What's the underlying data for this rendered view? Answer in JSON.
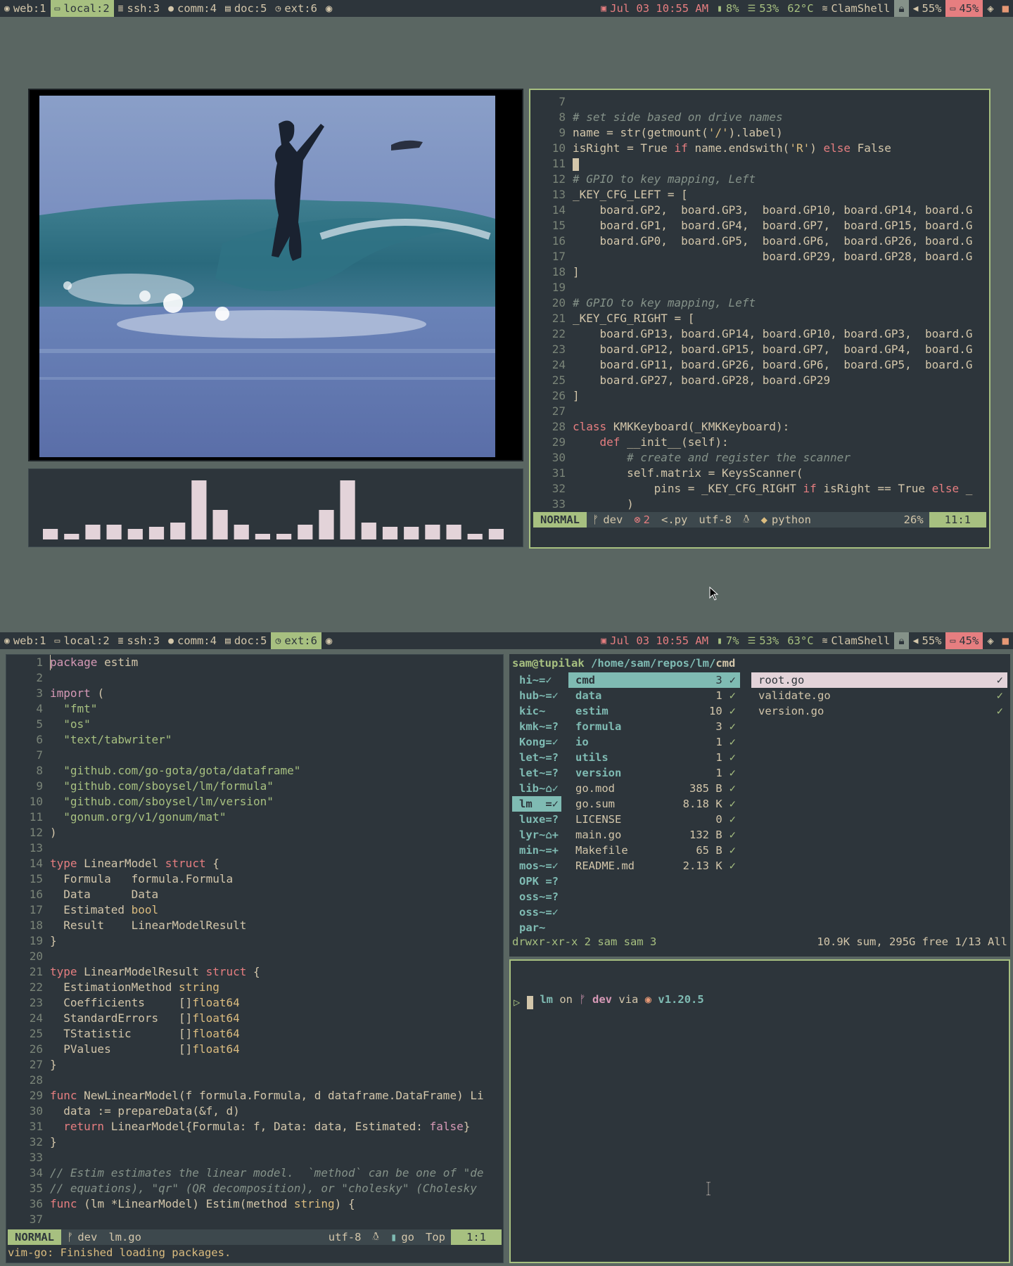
{
  "top_bar": {
    "workspaces": [
      {
        "icon": "chrome-icon",
        "label": "web:1",
        "active": false
      },
      {
        "icon": "monitor-icon",
        "label": "local:2",
        "active": true
      },
      {
        "icon": "server-icon",
        "label": "ssh:3",
        "active": false
      },
      {
        "icon": "chat-icon",
        "label": "comm:4",
        "active": false
      },
      {
        "icon": "document-icon",
        "label": "doc:5",
        "active": false
      },
      {
        "icon": "refresh-icon",
        "label": "ext:6",
        "active": false
      }
    ],
    "eye_icon": "eye-icon",
    "date": "Jul 03 10:55 AM",
    "memory": "8%",
    "cpu": "53%",
    "temp": "62°C",
    "wifi": "ClamShell",
    "volume": "55%",
    "battery": "45%"
  },
  "bottom_bar": {
    "workspaces": [
      {
        "label": "web:1",
        "active": false
      },
      {
        "label": "local:2",
        "active": false
      },
      {
        "label": "ssh:3",
        "active": false
      },
      {
        "label": "comm:4",
        "active": false
      },
      {
        "label": "doc:5",
        "active": false
      },
      {
        "label": "ext:6",
        "active": true
      }
    ],
    "date": "Jul 03 10:55 AM",
    "memory": "7%",
    "cpu": "53%",
    "temp": "63°C",
    "wifi": "ClamShell",
    "volume": "55%",
    "battery": "45%"
  },
  "visualizer": {
    "levels": [
      0.18,
      0.1,
      0.25,
      0.25,
      0.18,
      0.22,
      0.28,
      1.0,
      0.5,
      0.25,
      0.1,
      0.1,
      0.25,
      0.5,
      1.0,
      0.28,
      0.22,
      0.22,
      0.25,
      0.25,
      0.1,
      0.18
    ]
  },
  "python_editor": {
    "lines": [
      {
        "n": "7",
        "t": ""
      },
      {
        "n": "8",
        "t": "# set side based on drive names",
        "c": "cm"
      },
      {
        "n": "9",
        "t": "name = str(getmount('/').label)"
      },
      {
        "n": "10",
        "t": "isRight = True if name.endswith('R') else False"
      },
      {
        "n": "11",
        "t": ""
      },
      {
        "n": "12",
        "t": "# GPIO to key mapping, Left",
        "c": "cm"
      },
      {
        "n": "13",
        "t": "_KEY_CFG_LEFT = ["
      },
      {
        "n": "14",
        "t": "    board.GP2,  board.GP3,  board.GP10, board.GP14, board.G"
      },
      {
        "n": "15",
        "t": "    board.GP1,  board.GP4,  board.GP7,  board.GP15, board.G"
      },
      {
        "n": "16",
        "t": "    board.GP0,  board.GP5,  board.GP6,  board.GP26, board.G"
      },
      {
        "n": "17",
        "t": "                            board.GP29, board.GP28, board.G"
      },
      {
        "n": "18",
        "t": "]"
      },
      {
        "n": "19",
        "t": ""
      },
      {
        "n": "20",
        "t": "# GPIO to key mapping, Left",
        "c": "cm"
      },
      {
        "n": "21",
        "t": "_KEY_CFG_RIGHT = ["
      },
      {
        "n": "22",
        "t": "    board.GP13, board.GP14, board.GP10, board.GP3,  board.G"
      },
      {
        "n": "23",
        "t": "    board.GP12, board.GP15, board.GP7,  board.GP4,  board.G"
      },
      {
        "n": "24",
        "t": "    board.GP11, board.GP26, board.GP6,  board.GP5,  board.G"
      },
      {
        "n": "25",
        "t": "    board.GP27, board.GP28, board.GP29"
      },
      {
        "n": "26",
        "t": "]"
      },
      {
        "n": "27",
        "t": ""
      },
      {
        "n": "28",
        "t": "class KMKKeyboard(_KMKKeyboard):"
      },
      {
        "n": "29",
        "t": "    def __init__(self):"
      },
      {
        "n": "30",
        "t": "        # create and register the scanner",
        "c": "cm"
      },
      {
        "n": "31",
        "t": "        self.matrix = KeysScanner("
      },
      {
        "n": "32",
        "t": "            pins = _KEY_CFG_RIGHT if isRight == True else _"
      },
      {
        "n": "33",
        "t": "        )"
      }
    ],
    "status": {
      "mode": "NORMAL",
      "branch": "dev",
      "errors": "2",
      "ext": "<.py",
      "enc": "utf-8",
      "lang": "python",
      "pct": "26%",
      "pos": "11:1"
    }
  },
  "go_editor": {
    "lines": [
      {
        "n": "1",
        "t": "package estim"
      },
      {
        "n": "2",
        "t": ""
      },
      {
        "n": "3",
        "t": "import ("
      },
      {
        "n": "4",
        "t": "  \"fmt\""
      },
      {
        "n": "5",
        "t": "  \"os\""
      },
      {
        "n": "6",
        "t": "  \"text/tabwriter\""
      },
      {
        "n": "7",
        "t": ""
      },
      {
        "n": "8",
        "t": "  \"github.com/go-gota/gota/dataframe\""
      },
      {
        "n": "9",
        "t": "  \"github.com/sboysel/lm/formula\""
      },
      {
        "n": "10",
        "t": "  \"github.com/sboysel/lm/version\""
      },
      {
        "n": "11",
        "t": "  \"gonum.org/v1/gonum/mat\""
      },
      {
        "n": "12",
        "t": ")"
      },
      {
        "n": "13",
        "t": ""
      },
      {
        "n": "14",
        "t": "type LinearModel struct {"
      },
      {
        "n": "15",
        "t": "  Formula   formula.Formula"
      },
      {
        "n": "16",
        "t": "  Data      Data"
      },
      {
        "n": "17",
        "t": "  Estimated bool"
      },
      {
        "n": "18",
        "t": "  Result    LinearModelResult"
      },
      {
        "n": "19",
        "t": "}"
      },
      {
        "n": "20",
        "t": ""
      },
      {
        "n": "21",
        "t": "type LinearModelResult struct {"
      },
      {
        "n": "22",
        "t": "  EstimationMethod string"
      },
      {
        "n": "23",
        "t": "  Coefficients     []float64"
      },
      {
        "n": "24",
        "t": "  StandardErrors   []float64"
      },
      {
        "n": "25",
        "t": "  TStatistic       []float64"
      },
      {
        "n": "26",
        "t": "  PValues          []float64"
      },
      {
        "n": "27",
        "t": "}"
      },
      {
        "n": "28",
        "t": ""
      },
      {
        "n": "29",
        "t": "func NewLinearModel(f formula.Formula, d dataframe.DataFrame) Li"
      },
      {
        "n": "30",
        "t": "  data := prepareData(&f, d)"
      },
      {
        "n": "31",
        "t": "  return LinearModel{Formula: f, Data: data, Estimated: false}"
      },
      {
        "n": "32",
        "t": "}"
      },
      {
        "n": "33",
        "t": ""
      },
      {
        "n": "34",
        "t": "// Estim estimates the linear model.  `method` can be one of \"de",
        "c": "cm"
      },
      {
        "n": "35",
        "t": "// equations), \"qr\" (QR decomposition), or \"cholesky\" (Cholesky",
        "c": "cm"
      },
      {
        "n": "36",
        "t": "func (lm *LinearModel) Estim(method string) {"
      },
      {
        "n": "37",
        "t": ""
      }
    ],
    "status": {
      "mode": "NORMAL",
      "branch": "dev",
      "file": "lm.go",
      "enc": "utf-8",
      "lang": "go",
      "pct": "Top",
      "pos": "1:1"
    },
    "message": "vim-go: Finished loading packages."
  },
  "file_manager": {
    "header_user": "sam@tupilak",
    "header_path": "/home/sam/repos/lm/",
    "header_dir": "cmd",
    "left": [
      "hi~=✓",
      "hub~=✓",
      "kic~",
      "kmk~=?",
      "Kong=✓",
      "let~=?",
      "let~=?",
      "lib~⌂✓",
      "lm  =✓",
      "luxe=?",
      "lyr~⌂+",
      "min~=+",
      "mos~=✓",
      "OPK =?",
      "oss~=?",
      "oss~=✓",
      "par~"
    ],
    "middle": [
      {
        "name": "cmd",
        "size": "3",
        "st": "✓",
        "dir": true
      },
      {
        "name": "data",
        "size": "1",
        "st": "✓",
        "dir": true
      },
      {
        "name": "estim",
        "size": "10",
        "st": "✓",
        "dir": true
      },
      {
        "name": "formula",
        "size": "3",
        "st": "✓",
        "dir": true
      },
      {
        "name": "io",
        "size": "1",
        "st": "✓",
        "dir": true
      },
      {
        "name": "utils",
        "size": "1",
        "st": "✓",
        "dir": true
      },
      {
        "name": "version",
        "size": "1",
        "st": "✓",
        "dir": true
      },
      {
        "name": "go.mod",
        "size": "385 B",
        "st": "✓",
        "dir": false
      },
      {
        "name": "go.sum",
        "size": "8.18 K",
        "st": "✓",
        "dir": false
      },
      {
        "name": "LICENSE",
        "size": "0",
        "st": "✓",
        "dir": false
      },
      {
        "name": "main.go",
        "size": "132 B",
        "st": "✓",
        "dir": false
      },
      {
        "name": "Makefile",
        "size": "65 B",
        "st": "✓",
        "dir": false
      },
      {
        "name": "README.md",
        "size": "2.13 K",
        "st": "✓",
        "dir": false
      }
    ],
    "right": [
      {
        "name": "root.go",
        "st": "✓"
      },
      {
        "name": "validate.go",
        "st": "✓"
      },
      {
        "name": "version.go",
        "st": "✓"
      }
    ],
    "footer_left": "drwxr-xr-x 2 sam sam 3",
    "footer_right": "10.9K sum, 295G free  1/13  All"
  },
  "terminal": {
    "dir": "lm",
    "on": "on",
    "branch": "dev",
    "via": "via",
    "version": "v1.20.5",
    "prompt": "▷"
  }
}
